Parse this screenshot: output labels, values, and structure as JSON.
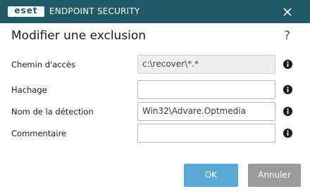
{
  "window": {
    "logo_text": "eset",
    "product_name": "ENDPOINT SECURITY",
    "close_icon": "close-icon"
  },
  "dialog": {
    "title": "Modifier une exclusion",
    "help_label": "?"
  },
  "form": {
    "path": {
      "label": "Chemin d'accès",
      "value": "c:\\recover\\*.*",
      "browse_label": "..."
    },
    "hash": {
      "label": "Hachage",
      "value": ""
    },
    "detection_name": {
      "label": "Nom de la détection",
      "value": "Win32\\Advare.Optmedia"
    },
    "comment": {
      "label": "Commentaire",
      "value": ""
    },
    "info_icon": "info-icon"
  },
  "buttons": {
    "ok_label": "OK",
    "cancel_label": "Annuler"
  },
  "colors": {
    "titlebar": "#1f5a66",
    "ok": "#5aa8d4",
    "cancel": "#9b9b9b"
  }
}
